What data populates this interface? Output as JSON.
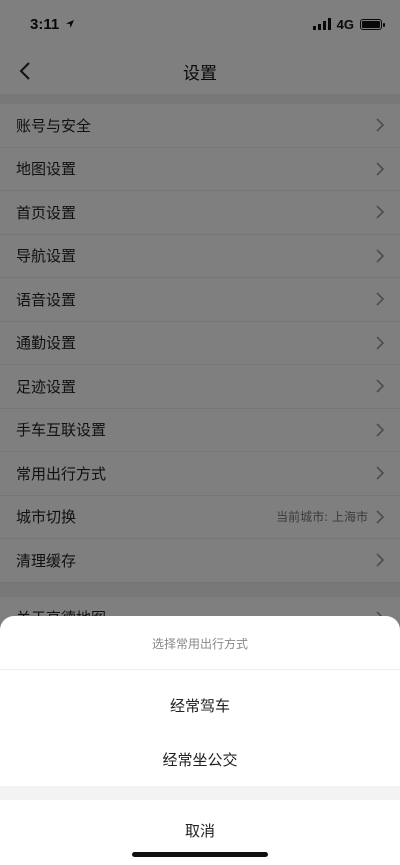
{
  "status_bar": {
    "time": "3:11",
    "network": "4G"
  },
  "nav": {
    "title": "设置"
  },
  "settings_items": [
    {
      "label": "账号与安全",
      "value": ""
    },
    {
      "label": "地图设置",
      "value": ""
    },
    {
      "label": "首页设置",
      "value": ""
    },
    {
      "label": "导航设置",
      "value": ""
    },
    {
      "label": "语音设置",
      "value": ""
    },
    {
      "label": "通勤设置",
      "value": ""
    },
    {
      "label": "足迹设置",
      "value": ""
    },
    {
      "label": "手车互联设置",
      "value": ""
    },
    {
      "label": "常用出行方式",
      "value": ""
    },
    {
      "label": "城市切换",
      "value": "当前城市: 上海市"
    },
    {
      "label": "清理缓存",
      "value": ""
    }
  ],
  "partial_item": {
    "label": "关于高德地图"
  },
  "action_sheet": {
    "title": "选择常用出行方式",
    "options": [
      "经常驾车",
      "经常坐公交"
    ],
    "cancel_label": "取消"
  }
}
